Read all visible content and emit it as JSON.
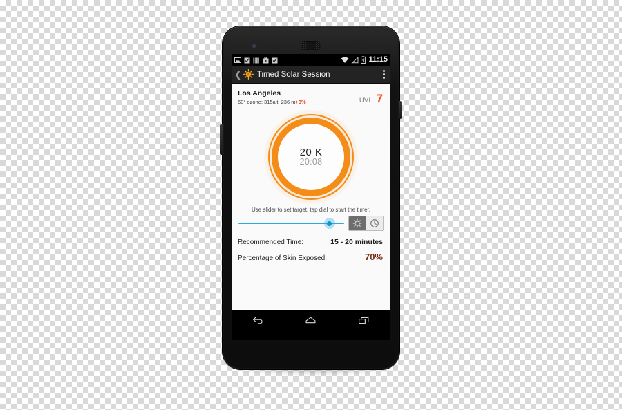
{
  "app": {
    "title": "Timed Solar Session",
    "icon": "sun-icon",
    "back_icon": "back-chevron-icon",
    "overflow_icon": "overflow-menu-icon"
  },
  "status_bar": {
    "time": "11:15",
    "left_icons": [
      "image-icon",
      "checkbox-icon",
      "bars-icon",
      "briefcase-icon",
      "checkbox-icon"
    ],
    "right_icons": [
      "wifi-icon",
      "signal-icon",
      "battery-charging-icon"
    ]
  },
  "location": {
    "city": "Los Angeles",
    "detail_prefix": "60° ozone: 315alt: 236 m",
    "detail_delta": "+3%",
    "uvi_label": "UVI",
    "uvi_value": "7"
  },
  "dial": {
    "value": "20 K",
    "time": "20:08",
    "ring_color": "#f48c18"
  },
  "hint": {
    "text": "Use slider to set target, tap dial to start the timer."
  },
  "slider": {
    "position_percent": "86",
    "track_color": "#29abe2",
    "mode_buttons": [
      {
        "name": "sun-mode-button",
        "icon": "sun-gear-icon",
        "selected": true
      },
      {
        "name": "timer-mode-button",
        "icon": "clock-icon",
        "selected": false
      }
    ]
  },
  "info": {
    "rows": [
      {
        "label": "Recommended Time:",
        "value": "15 - 20 minutes",
        "accent": false
      },
      {
        "label": "Percentage of Skin Exposed:",
        "value": "70%",
        "accent": true
      }
    ]
  },
  "nav_bar": {
    "buttons": [
      "back-nav-icon",
      "home-nav-icon",
      "recents-nav-icon"
    ]
  }
}
